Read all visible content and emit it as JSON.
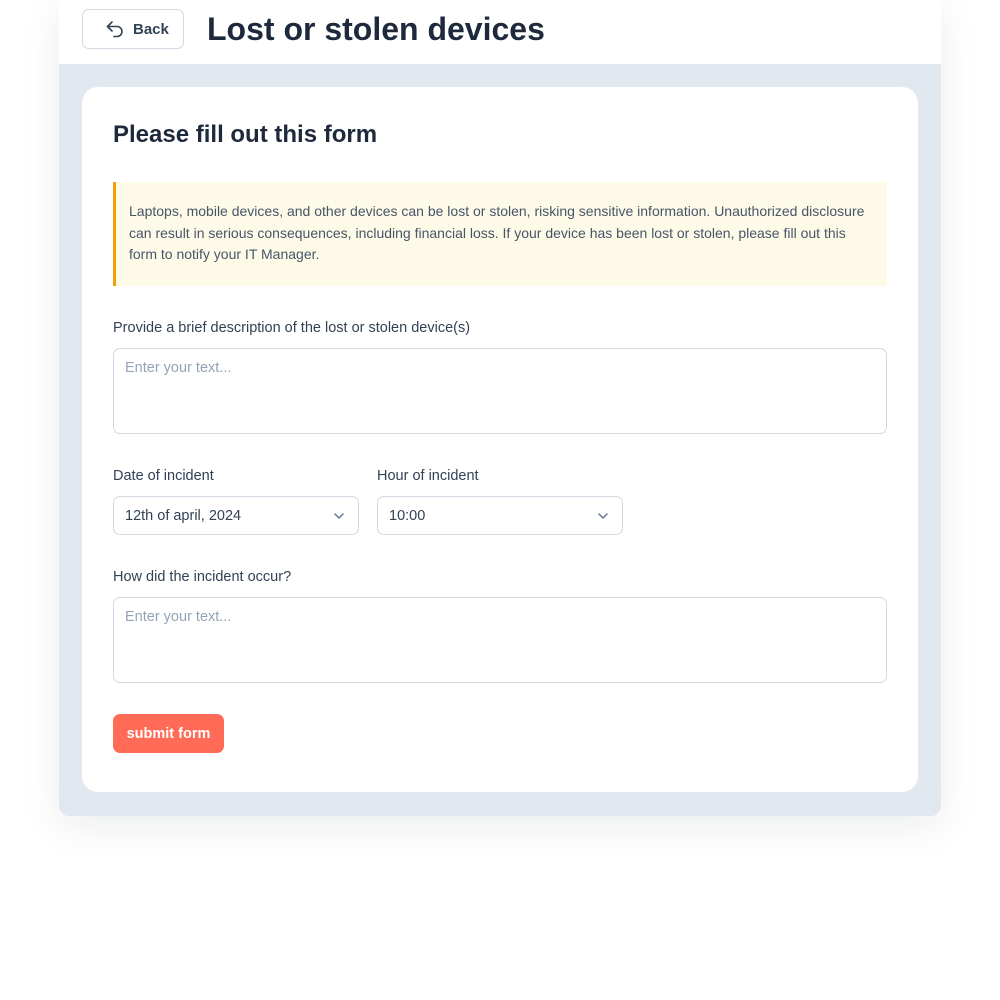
{
  "header": {
    "back_label": "Back",
    "title": "Lost or stolen devices"
  },
  "form": {
    "title": "Please fill out this form",
    "notice": "Laptops, mobile devices, and other devices can be lost or stolen, risking sensitive information. Unauthorized disclosure can result in serious consequences, including financial loss. If your device has been lost or stolen, please fill out this form to notify your IT Manager.",
    "description_label": "Provide a brief description of the lost or stolen device(s)",
    "description_placeholder": "Enter your text...",
    "date_label": "Date of incident",
    "date_value": "12th of april, 2024",
    "hour_label": "Hour of incident",
    "hour_value": "10:00",
    "occurrence_label": "How did the incident occur?",
    "occurrence_placeholder": "Enter your text...",
    "submit_label": "submit form"
  },
  "colors": {
    "accent": "#ff6b57",
    "notice_border": "#f59e0b",
    "notice_bg": "#fefae8",
    "backdrop": "#e2e8f0"
  },
  "icons": {
    "back": "back-arrow-icon",
    "dropdown": "chevron-down-icon"
  }
}
